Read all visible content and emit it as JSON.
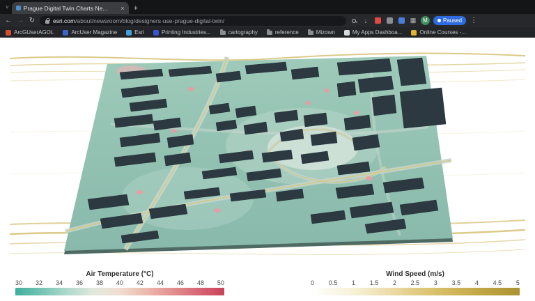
{
  "browser": {
    "tab_title": "Prague Digital Twin Charts Ne...",
    "url_domain": "esri.com",
    "url_path": "/about/newsroom/blog/designers-use-prague-digital-twin/",
    "avatar_letter": "M",
    "paused_label": "Paused",
    "glyphs": {
      "close": "×",
      "new_tab": "+",
      "back": "←",
      "forward": "→",
      "reload": "↻",
      "kebab": "⋮",
      "apps": "▦",
      "download": "↓",
      "tab_chevron": "˅"
    },
    "bookmarks": [
      {
        "label": "ArcGUserAGOL",
        "type": "site",
        "color": "#d4502e"
      },
      {
        "label": "ArcUser Magazine",
        "type": "site",
        "color": "#3a66c8"
      },
      {
        "label": "Esri",
        "type": "site",
        "color": "#42a0d8"
      },
      {
        "label": "Printing Industries...",
        "type": "site",
        "color": "#3a55cc"
      },
      {
        "label": "cartography",
        "type": "folder"
      },
      {
        "label": "reference",
        "type": "folder"
      },
      {
        "label": "Mizown",
        "type": "folder"
      },
      {
        "label": "My Apps Dashboa...",
        "type": "site",
        "color": "#d8dadc"
      },
      {
        "label": "Online Courses -...",
        "type": "site",
        "color": "#e0b52e"
      }
    ]
  },
  "chart_data": [
    {
      "type": "heatmap",
      "title": "Air Temperature (°C)",
      "tick_labels": [
        "30",
        "32",
        "34",
        "36",
        "38",
        "40",
        "42",
        "44",
        "46",
        "48",
        "50"
      ],
      "range": [
        30,
        50
      ],
      "unit": "°C",
      "legend_position": "bottom-left",
      "gradient": [
        "#3fae9e",
        "#74c4b4",
        "#aedacd",
        "#e2e8dd",
        "#f0ded1",
        "#ecb9ad",
        "#e2908f",
        "#d76676",
        "#c94258"
      ]
    },
    {
      "type": "heatmap",
      "title": "Wind Speed (m/s)",
      "tick_labels": [
        "0",
        "0.5",
        "1",
        "1.5",
        "2",
        "2.5",
        "3",
        "3.5",
        "4",
        "4.5",
        "5"
      ],
      "range": [
        0,
        5
      ],
      "unit": "m/s",
      "legend_position": "bottom-right",
      "gradient": [
        "#ffffff",
        "#f7f2d8",
        "#ead9a2",
        "#d8c06a",
        "#c3a847",
        "#ab9232"
      ]
    }
  ]
}
